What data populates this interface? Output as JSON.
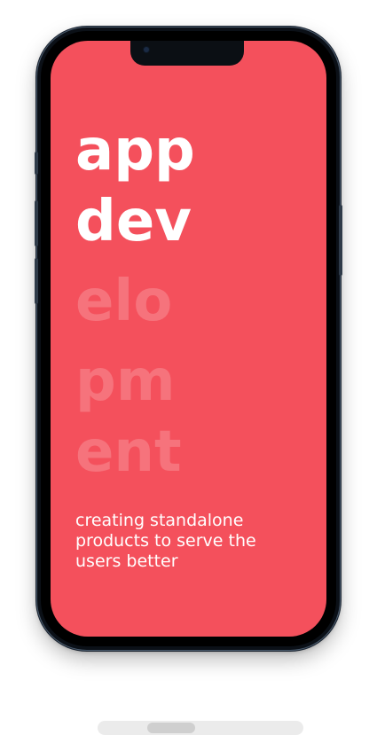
{
  "headline": {
    "line1": "app",
    "line2": "dev",
    "line3": "elo",
    "line4": "pm",
    "line5": "ent"
  },
  "tagline": "creating standalone products to serve the users better",
  "colors": {
    "screen_bg": "#f4505c",
    "text_primary": "#ffffff",
    "phone_frame": "#0b1017"
  },
  "carousel": {
    "scroll_position": 0.24
  }
}
